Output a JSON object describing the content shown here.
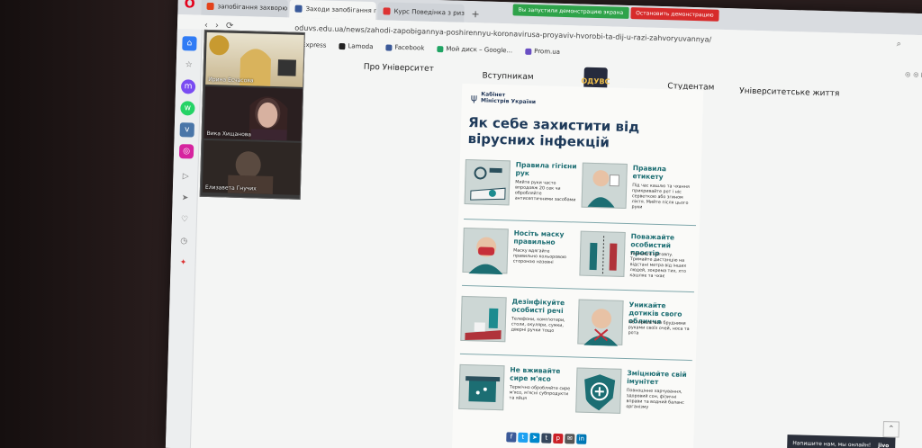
{
  "browser": {
    "tabs": [
      {
        "label": "запобігання захворюванн...",
        "fav_color": "#e3421b"
      },
      {
        "label": "Заходи запобігання пошир...",
        "fav_color": "#3a5a9a"
      },
      {
        "label": "Курс Поведінка з ризиком...",
        "fav_color": "#d33"
      }
    ],
    "url": "oduvs.edu.ua/news/zahodi-zapobigannya-poshirennyu-koronavirusa-proyaviv-hvorobi-ta-dij-u-razi-zahvoryuvannya/",
    "demo_message": "Вы запустили демонстрацию экрана",
    "demo_stop": "Остановить демонстрацию",
    "bookmarks": [
      {
        "label": "AliExpress",
        "color": "#e43"
      },
      {
        "label": "Lamoda",
        "color": "#222"
      },
      {
        "label": "Facebook",
        "color": "#3b5998"
      },
      {
        "label": "Мой диск – Google...",
        "color": "#1fa463"
      },
      {
        "label": "Prom.ua",
        "color": "#6a4fc3"
      }
    ]
  },
  "site_nav": {
    "about": "Про Університет",
    "applicants": "Вступникам",
    "students": "Студентам",
    "life": "Університетське життя",
    "logo_text": "ОДУВС"
  },
  "video": {
    "participants": [
      {
        "name": "Ирина Есчасова"
      },
      {
        "name": "Вика Хищанова"
      },
      {
        "name": "Елизавета Гнучих"
      }
    ]
  },
  "poster": {
    "gov": "Кабінет\nМіністрів України",
    "title": "Як себе захистити від вірусних інфекцій",
    "tips": [
      {
        "title": "Правила гігієни рук",
        "desc": "Мийте руки часто впродовж 20 сек чи обробляйте антисептичними засобами"
      },
      {
        "title": "Правила етикету",
        "desc": "Під час кашлю та чхання прикривайте рот і ніс серветкою або згином ліктя. Мийте після цього руки"
      },
      {
        "title": "Носіть маску правильно",
        "desc": "Маску вдягайте правильно кольоровою стороною назовні"
      },
      {
        "title": "Поважайте особистий простір",
        "desc": "Уникайте натовпу. Тримайте дистанцію на відстані метра від інших людей, зокрема тих, хто кашляє та чхає"
      },
      {
        "title": "Дезінфікуйте особисті речі",
        "desc": "Телефони, комп'ютери, столи, окуляри, сумки, дверні ручки тощо"
      },
      {
        "title": "Уникайте дотиків свого обличчя",
        "desc": "Не торкайтеся брудними руками своїх очей, носа та рота"
      },
      {
        "title": "Не вживайте сире м'ясо",
        "desc": "Термічно обробляйте сире м'ясо, м'ясні субпродукти та яйця"
      },
      {
        "title": "Зміцнюйте свій імунітет",
        "desc": "Повноцінне харчування, здоровий сон, фізичні вправи та водний баланс організму"
      }
    ]
  },
  "chat": {
    "label": "Напишите нам, мы онлайн!",
    "brand": "jivo"
  }
}
